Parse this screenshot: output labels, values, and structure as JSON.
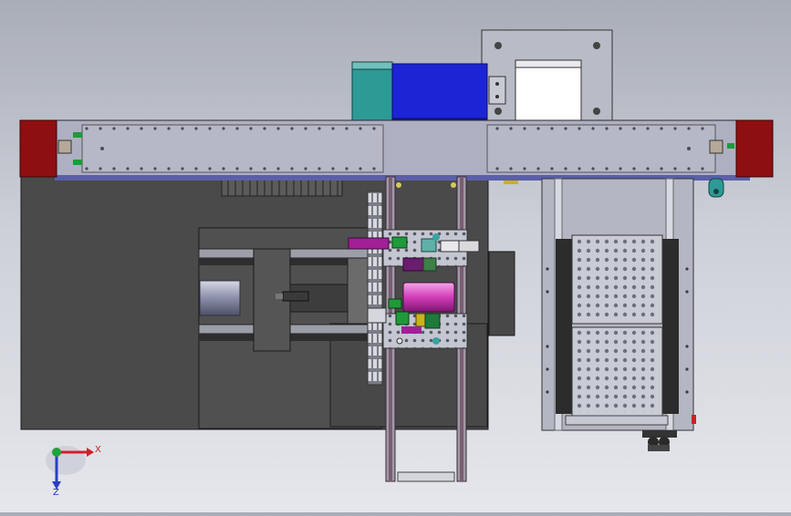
{
  "triad": {
    "x_label": "X",
    "z_label": "Z",
    "x_color": "#d0202a",
    "y_color": "#1fa33a",
    "z_color": "#2a3fc4"
  },
  "colors": {
    "background_top": "#a9adb8",
    "background_bottom": "#e6e7ec",
    "base_plate": "#4a4a4a",
    "gantry_beam": "#aeb0c2",
    "end_cap": "#8e0f12",
    "carriage_blue": "#1c24d6",
    "carriage_blue_dark": "#0f1896",
    "motor_teal": "#2d9a96",
    "steel_plate": "#b9bbc6",
    "magenta_part": "#cc1ca8",
    "green_part": "#1f9a3a",
    "yellow_part": "#c9b21f"
  }
}
